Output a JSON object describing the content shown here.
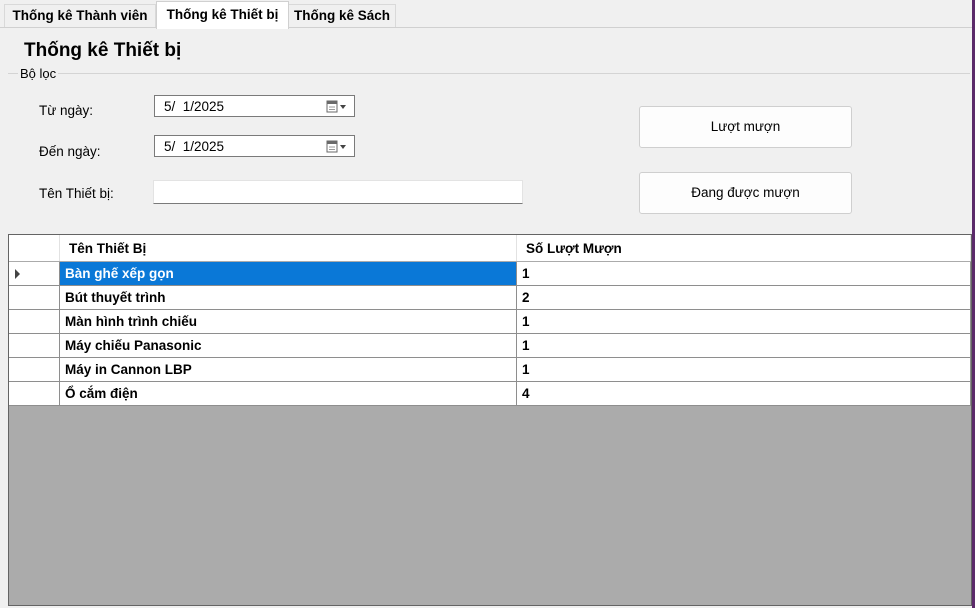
{
  "tabs": [
    {
      "label": "Thống kê Thành viên",
      "active": false
    },
    {
      "label": "Thống kê Thiết bị",
      "active": true
    },
    {
      "label": "Thống kê Sách",
      "active": false
    }
  ],
  "page": {
    "title": "Thống kê Thiết bị"
  },
  "filter": {
    "group_label": "Bộ lọc",
    "from_label": "Từ ngày:",
    "from_value": "5/  1/2025",
    "to_label": "Đến ngày:",
    "to_value": "5/  1/2025",
    "name_label": "Tên Thiết bị:",
    "name_value": "",
    "btn_borrow_count": "Lượt mượn",
    "btn_borrowing": "Đang được mượn"
  },
  "grid": {
    "columns": [
      "Tên Thiết Bị",
      "Số Lượt Mượn"
    ],
    "rows": [
      {
        "name": "Bàn ghế xếp gọn",
        "count": "1"
      },
      {
        "name": "Bút thuyết trình",
        "count": "2"
      },
      {
        "name": "Màn hình trình chiếu",
        "count": "1"
      },
      {
        "name": "Máy chiếu Panasonic",
        "count": "1"
      },
      {
        "name": "Máy in Cannon LBP",
        "count": "1"
      },
      {
        "name": "Ổ cắm điện",
        "count": "4"
      }
    ],
    "selected_row": 0
  },
  "colors": {
    "selection": "#0a78d7",
    "grid_empty": "#ababab",
    "window_accent": "#5b2a6a"
  }
}
